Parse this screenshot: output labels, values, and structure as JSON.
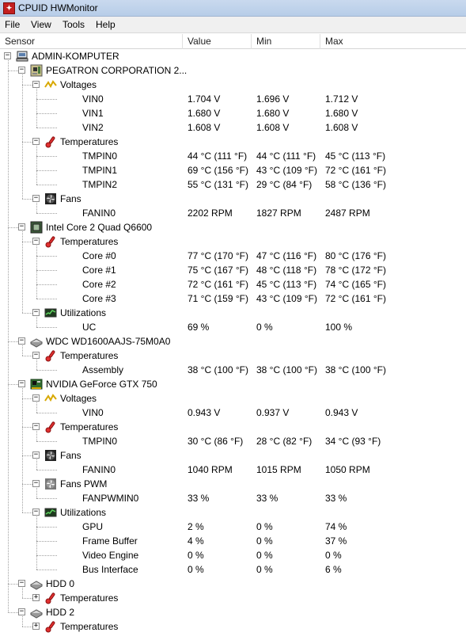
{
  "window": {
    "title": "CPUID HWMonitor"
  },
  "menu": [
    "File",
    "View",
    "Tools",
    "Help"
  ],
  "columns": {
    "sensor": "Sensor",
    "value": "Value",
    "min": "Min",
    "max": "Max"
  },
  "rows": [
    {
      "level": 0,
      "expander": "minus",
      "icon": "computer-icon",
      "label": "ADMIN-KOMPUTER"
    },
    {
      "level": 1,
      "expander": "minus",
      "icon": "motherboard-icon",
      "label": "PEGATRON CORPORATION 2..."
    },
    {
      "level": 2,
      "expander": "minus",
      "icon": "voltage-icon",
      "label": "Voltages"
    },
    {
      "level": 3,
      "label": "VIN0",
      "value": "1.704 V",
      "min": "1.696 V",
      "max": "1.712 V"
    },
    {
      "level": 3,
      "label": "VIN1",
      "value": "1.680 V",
      "min": "1.680 V",
      "max": "1.680 V"
    },
    {
      "level": 3,
      "label": "VIN2",
      "value": "1.608 V",
      "min": "1.608 V",
      "max": "1.608 V"
    },
    {
      "level": 2,
      "expander": "minus",
      "icon": "thermometer-icon",
      "label": "Temperatures"
    },
    {
      "level": 3,
      "label": "TMPIN0",
      "value": "44 °C  (111 °F)",
      "min": "44 °C  (111 °F)",
      "max": "45 °C  (113 °F)"
    },
    {
      "level": 3,
      "label": "TMPIN1",
      "value": "69 °C  (156 °F)",
      "min": "43 °C  (109 °F)",
      "max": "72 °C  (161 °F)"
    },
    {
      "level": 3,
      "label": "TMPIN2",
      "value": "55 °C  (131 °F)",
      "min": "29 °C  (84 °F)",
      "max": "58 °C  (136 °F)"
    },
    {
      "level": 2,
      "expander": "minus",
      "icon": "fan-icon",
      "label": "Fans"
    },
    {
      "level": 3,
      "label": "FANIN0",
      "value": "2202 RPM",
      "min": "1827 RPM",
      "max": "2487 RPM"
    },
    {
      "level": 1,
      "expander": "minus",
      "icon": "cpu-icon",
      "label": "Intel Core 2 Quad Q6600"
    },
    {
      "level": 2,
      "expander": "minus",
      "icon": "thermometer-icon",
      "label": "Temperatures"
    },
    {
      "level": 3,
      "label": "Core #0",
      "value": "77 °C  (170 °F)",
      "min": "47 °C  (116 °F)",
      "max": "80 °C  (176 °F)"
    },
    {
      "level": 3,
      "label": "Core #1",
      "value": "75 °C  (167 °F)",
      "min": "48 °C  (118 °F)",
      "max": "78 °C  (172 °F)"
    },
    {
      "level": 3,
      "label": "Core #2",
      "value": "72 °C  (161 °F)",
      "min": "45 °C  (113 °F)",
      "max": "74 °C  (165 °F)"
    },
    {
      "level": 3,
      "label": "Core #3",
      "value": "71 °C  (159 °F)",
      "min": "43 °C  (109 °F)",
      "max": "72 °C  (161 °F)"
    },
    {
      "level": 2,
      "expander": "minus",
      "icon": "utilization-icon",
      "label": "Utilizations"
    },
    {
      "level": 3,
      "label": "UC",
      "value": "69 %",
      "min": "0 %",
      "max": "100 %"
    },
    {
      "level": 1,
      "expander": "minus",
      "icon": "hdd-icon",
      "label": "WDC WD1600AAJS-75M0A0"
    },
    {
      "level": 2,
      "expander": "minus",
      "icon": "thermometer-icon",
      "label": "Temperatures"
    },
    {
      "level": 3,
      "label": "Assembly",
      "value": "38 °C  (100 °F)",
      "min": "38 °C  (100 °F)",
      "max": "38 °C  (100 °F)"
    },
    {
      "level": 1,
      "expander": "minus",
      "icon": "gpu-icon",
      "label": "NVIDIA GeForce GTX 750"
    },
    {
      "level": 2,
      "expander": "minus",
      "icon": "voltage-icon",
      "label": "Voltages"
    },
    {
      "level": 3,
      "label": "VIN0",
      "value": "0.943 V",
      "min": "0.937 V",
      "max": "0.943 V"
    },
    {
      "level": 2,
      "expander": "minus",
      "icon": "thermometer-icon",
      "label": "Temperatures"
    },
    {
      "level": 3,
      "label": "TMPIN0",
      "value": "30 °C  (86 °F)",
      "min": "28 °C  (82 °F)",
      "max": "34 °C  (93 °F)"
    },
    {
      "level": 2,
      "expander": "minus",
      "icon": "fan-icon",
      "label": "Fans"
    },
    {
      "level": 3,
      "label": "FANIN0",
      "value": "1040 RPM",
      "min": "1015 RPM",
      "max": "1050 RPM"
    },
    {
      "level": 2,
      "expander": "minus",
      "icon": "fan-pwm-icon",
      "label": "Fans PWM"
    },
    {
      "level": 3,
      "label": "FANPWMIN0",
      "value": "33 %",
      "min": "33 %",
      "max": "33 %"
    },
    {
      "level": 2,
      "expander": "minus",
      "icon": "utilization-icon",
      "label": "Utilizations"
    },
    {
      "level": 3,
      "label": "GPU",
      "value": "2 %",
      "min": "0 %",
      "max": "74 %"
    },
    {
      "level": 3,
      "label": "Frame Buffer",
      "value": "4 %",
      "min": "0 %",
      "max": "37 %"
    },
    {
      "level": 3,
      "label": "Video Engine",
      "value": "0 %",
      "min": "0 %",
      "max": "0 %"
    },
    {
      "level": 3,
      "label": "Bus Interface",
      "value": "0 %",
      "min": "0 %",
      "max": "6 %"
    },
    {
      "level": 1,
      "expander": "minus",
      "icon": "hdd-icon",
      "label": "HDD 0"
    },
    {
      "level": 2,
      "expander": "plus",
      "icon": "thermometer-icon",
      "label": "Temperatures"
    },
    {
      "level": 1,
      "expander": "minus",
      "icon": "hdd-icon",
      "label": "HDD 2"
    },
    {
      "level": 2,
      "expander": "plus",
      "icon": "thermometer-icon",
      "label": "Temperatures"
    }
  ],
  "colors": {
    "title_bar": "#c9d9ee",
    "menu_bar": "#f0f0f0",
    "tree_lines": "#a0a0a0"
  }
}
